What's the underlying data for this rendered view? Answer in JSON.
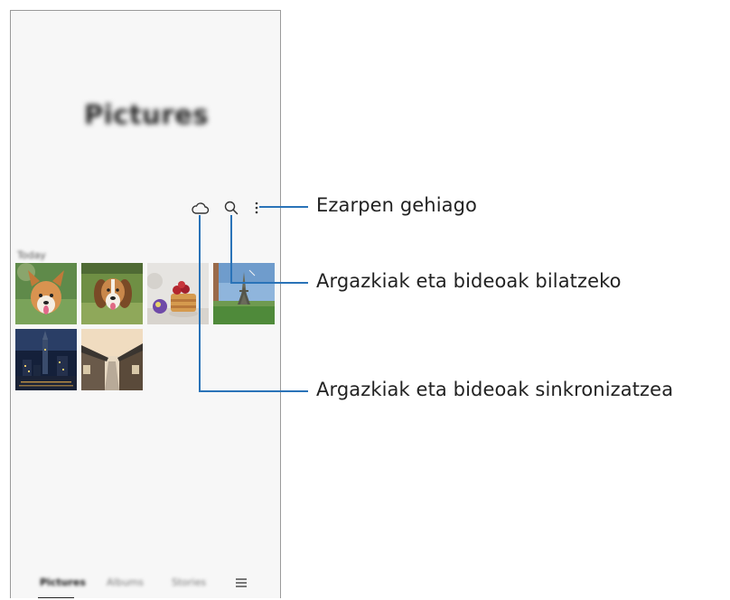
{
  "screen": {
    "title": "Pictures",
    "section_label": "Today",
    "toolbar": {
      "sync_icon": "cloud-icon",
      "search_icon": "search-icon",
      "more_icon": "more-vertical-icon"
    },
    "thumbnails": [
      "corgi-photo",
      "beagle-photo",
      "pancakes-photo",
      "eiffel-tower-photo",
      "city-night-photo",
      "hanok-street-photo"
    ],
    "bottom_nav": {
      "tabs": [
        "Pictures",
        "Albums",
        "Stories"
      ],
      "active_tab": "Pictures",
      "menu_icon": "menu-icon"
    }
  },
  "callouts": {
    "more_options": "Ezarpen gehiago",
    "search": "Argazkiak eta bideoak bilatzeko",
    "sync": "Argazkiak eta bideoak sinkronizatzea"
  },
  "colors": {
    "callout_line": "#2a73b8",
    "frame": "#9a9a9a",
    "screen_background": "#f7f7f7"
  }
}
